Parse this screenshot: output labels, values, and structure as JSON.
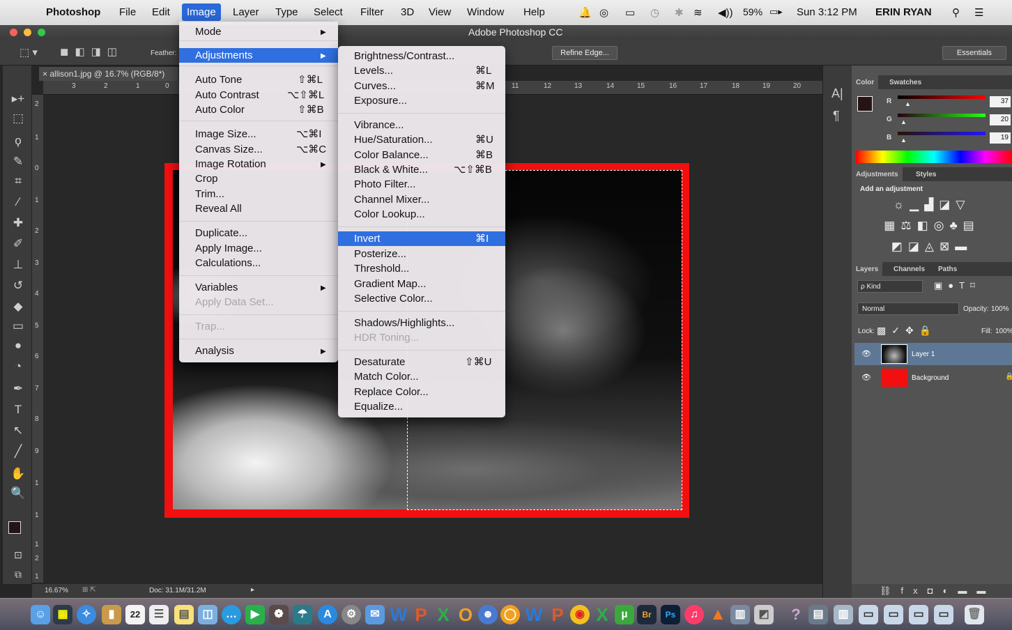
{
  "menubar": {
    "apple": "",
    "items": [
      "Photoshop",
      "File",
      "Edit",
      "Image",
      "Layer",
      "Type",
      "Select",
      "Filter",
      "3D",
      "View",
      "Window",
      "Help"
    ],
    "battery": "59%",
    "clock": "Sun 3:12 PM",
    "user": "ERIN RYAN"
  },
  "window": {
    "title": "Adobe Photoshop CC"
  },
  "options": {
    "feather_label": "Feather:",
    "refine_edge": "Refine Edge...",
    "workspace": "Essentials"
  },
  "document": {
    "tab": "allison1.jpg @ 16.7% (RGB/8*)",
    "zoom": "16.67%",
    "doc_size": "Doc: 31.1M/31.2M"
  },
  "ruler": {
    "h": [
      "3",
      "2",
      "1",
      "0",
      "11",
      "12",
      "13",
      "14",
      "15",
      "16",
      "17",
      "18",
      "19",
      "20"
    ],
    "v": [
      "2",
      "1",
      "0",
      "1",
      "2",
      "3",
      "4",
      "5",
      "6",
      "7",
      "8",
      "9",
      "1",
      "1",
      "1",
      "2",
      "1"
    ]
  },
  "image_menu": {
    "items": [
      {
        "label": "Mode",
        "sub": true
      },
      {
        "label": "Adjustments",
        "sub": true,
        "highlight": true
      },
      {
        "label": "Auto Tone",
        "shortcut": "⇧⌘L"
      },
      {
        "label": "Auto Contrast",
        "shortcut": "⌥⇧⌘L"
      },
      {
        "label": "Auto Color",
        "shortcut": "⇧⌘B"
      },
      {
        "label": "Image Size...",
        "shortcut": "⌥⌘I"
      },
      {
        "label": "Canvas Size...",
        "shortcut": "⌥⌘C"
      },
      {
        "label": "Image Rotation",
        "sub": true
      },
      {
        "label": "Crop"
      },
      {
        "label": "Trim..."
      },
      {
        "label": "Reveal All"
      },
      {
        "label": "Duplicate..."
      },
      {
        "label": "Apply Image..."
      },
      {
        "label": "Calculations..."
      },
      {
        "label": "Variables",
        "sub": true
      },
      {
        "label": "Apply Data Set...",
        "disabled": true
      },
      {
        "label": "Trap...",
        "disabled": true
      },
      {
        "label": "Analysis",
        "sub": true
      }
    ]
  },
  "adjustments_menu": {
    "items": [
      {
        "label": "Brightness/Contrast..."
      },
      {
        "label": "Levels...",
        "shortcut": "⌘L"
      },
      {
        "label": "Curves...",
        "shortcut": "⌘M"
      },
      {
        "label": "Exposure..."
      },
      {
        "label": "Vibrance..."
      },
      {
        "label": "Hue/Saturation...",
        "shortcut": "⌘U"
      },
      {
        "label": "Color Balance...",
        "shortcut": "⌘B"
      },
      {
        "label": "Black & White...",
        "shortcut": "⌥⇧⌘B"
      },
      {
        "label": "Photo Filter..."
      },
      {
        "label": "Channel Mixer..."
      },
      {
        "label": "Color Lookup..."
      },
      {
        "label": "Invert",
        "shortcut": "⌘I",
        "highlight": true
      },
      {
        "label": "Posterize..."
      },
      {
        "label": "Threshold..."
      },
      {
        "label": "Gradient Map..."
      },
      {
        "label": "Selective Color..."
      },
      {
        "label": "Shadows/Highlights..."
      },
      {
        "label": "HDR Toning...",
        "disabled": true
      },
      {
        "label": "Desaturate",
        "shortcut": "⇧⌘U"
      },
      {
        "label": "Match Color..."
      },
      {
        "label": "Replace Color..."
      },
      {
        "label": "Equalize..."
      }
    ]
  },
  "color_panel": {
    "tabs": [
      "Color",
      "Swatches"
    ],
    "r_label": "R",
    "g_label": "G",
    "b_label": "B",
    "r": "37",
    "g": "20",
    "b": "19",
    "foreground": "#251413"
  },
  "adjustments_panel": {
    "tabs": [
      "Adjustments",
      "Styles"
    ],
    "heading": "Add an adjustment"
  },
  "layers_panel": {
    "tabs": [
      "Layers",
      "Channels",
      "Paths"
    ],
    "kind": "ρ Kind",
    "blend": "Normal",
    "opacity_label": "Opacity:",
    "opacity": "100%",
    "lock_label": "Lock:",
    "fill_label": "Fill:",
    "fill": "100%",
    "layers": [
      {
        "name": "Layer 1",
        "selected": true
      },
      {
        "name": "Background",
        "color": "#f20f0f"
      }
    ]
  },
  "dock": {
    "calendar_day": "22"
  },
  "colors": {
    "accent": "#2f6fe0",
    "frame": "#f20f0f"
  }
}
